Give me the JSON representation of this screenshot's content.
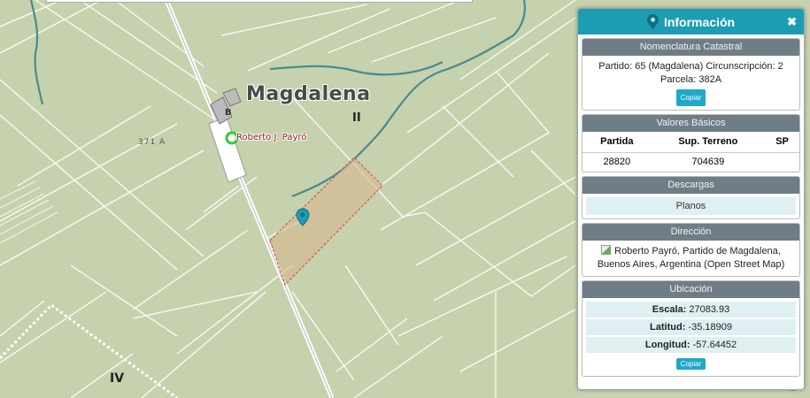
{
  "map": {
    "town_label": "Magdalena",
    "zone_ii": "II",
    "zone_iv": "IV",
    "parcel_label": "371 A",
    "station_block": "B",
    "station_label": "Roberto J. Payró"
  },
  "panel": {
    "title": "Información",
    "close": "✖",
    "nomenclatura": {
      "header": "Nomenclatura Catastral",
      "line1": "Partido: 65 (Magdalena) Circunscripción: 2",
      "line2": "Parcela: 382A",
      "copy": "Copiar"
    },
    "valores": {
      "header": "Valores Básicos",
      "columns": [
        "Partida",
        "Sup. Terreno",
        "SP"
      ],
      "row": [
        "28820",
        "704639",
        ""
      ]
    },
    "descargas": {
      "header": "Descargas",
      "planos": "Planos"
    },
    "direccion": {
      "header": "Dirección",
      "text": "Roberto Payró, Partido de Magdalena, Buenos Aires, Argentina (Open Street Map)"
    },
    "ubicacion": {
      "header": "Ubicación",
      "escala_label": "Escala:",
      "escala": "27083.93",
      "latitud_label": "Latitud:",
      "latitud": "-35.18909",
      "longitud_label": "Longitud:",
      "longitud": "-57.64452",
      "copy": "Copiar"
    }
  },
  "colors": {
    "map_bg": "#c6d2ad",
    "header": "#1d9db3",
    "section_head": "#6f7e86",
    "river": "#4a8a8e",
    "parcel_fill": "#d6b88f",
    "parcel_border": "#d04545"
  }
}
